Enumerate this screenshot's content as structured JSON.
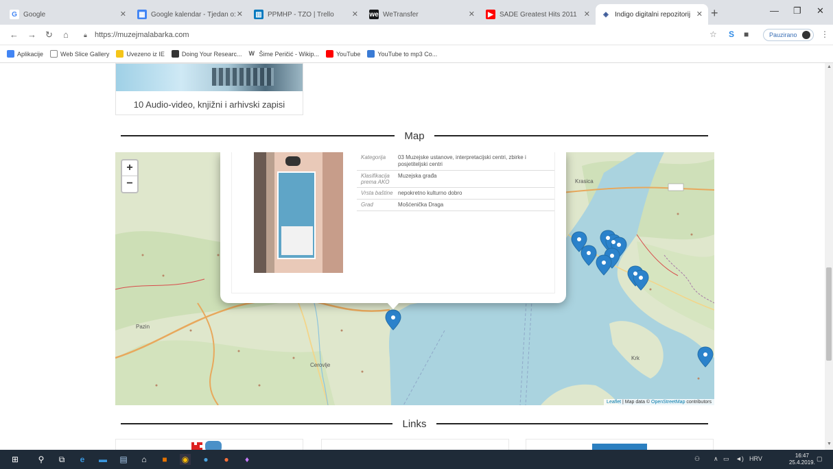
{
  "browser": {
    "tabs": [
      {
        "title": "Google",
        "favicon": "google-icon",
        "color": "#ffffff"
      },
      {
        "title": "Google kalendar - Tjedan o:",
        "favicon": "calendar-icon",
        "color": "#4285f4"
      },
      {
        "title": "PPMHP - TZO | Trello",
        "favicon": "trello-icon",
        "color": "#0079bf"
      },
      {
        "title": "WeTransfer",
        "favicon": "wetransfer-icon",
        "color": "#17181a"
      },
      {
        "title": "SADE Greatest Hits 2011",
        "favicon": "youtube-icon",
        "color": "#ff0000"
      },
      {
        "title": "Indigo digitalni repozitorij",
        "favicon": "indigo-icon",
        "color": "#ffffff"
      }
    ],
    "url": "https://muzejmalabarka.com",
    "profile_label": "Pauzirano",
    "bookmarks": [
      {
        "label": "Aplikacije",
        "color": "#4285f4"
      },
      {
        "label": "Web Slice Gallery",
        "color": "#888888"
      },
      {
        "label": "Uvezeno iz IE",
        "color": "#f5c518"
      },
      {
        "label": "Doing Your Researc...",
        "color": "#333333"
      },
      {
        "label": "Šime Peričić - Wikip...",
        "color": "#555555"
      },
      {
        "label": "YouTube",
        "color": "#ff0000"
      },
      {
        "label": "YouTube to mp3 Co...",
        "color": "#3a7bd5"
      }
    ]
  },
  "page": {
    "top_card_caption": "10 Audio-video, knjižni i arhivski zapisi",
    "map_section_title": "Map",
    "links_section_title": "Links",
    "map": {
      "zoom_in": "+",
      "zoom_out": "−",
      "place_labels": [
        "Krasica",
        "Pazin",
        "Cerovlje",
        "Krk"
      ],
      "attribution_leaflet": "Leaflet",
      "attribution_text": "| Map data ©",
      "attribution_osm": "OpenStreetMap",
      "attribution_suffix": "contributors",
      "popup": {
        "rows": [
          {
            "key": "Kategorija",
            "value": "03 Muzejske ustanove, interpretacijski centri, zbirke i posjetiteljski centri"
          },
          {
            "key": "Klasifikacija prema AKO",
            "value": "Muzejska građa"
          },
          {
            "key": "Vrsta baštine",
            "value": "nepokretno kulturno dobro"
          },
          {
            "key": "Grad",
            "value": "Mošćenička Draga"
          }
        ]
      }
    }
  },
  "taskbar": {
    "lang": "HRV",
    "time": "16:47",
    "date": "25.4.2019."
  }
}
